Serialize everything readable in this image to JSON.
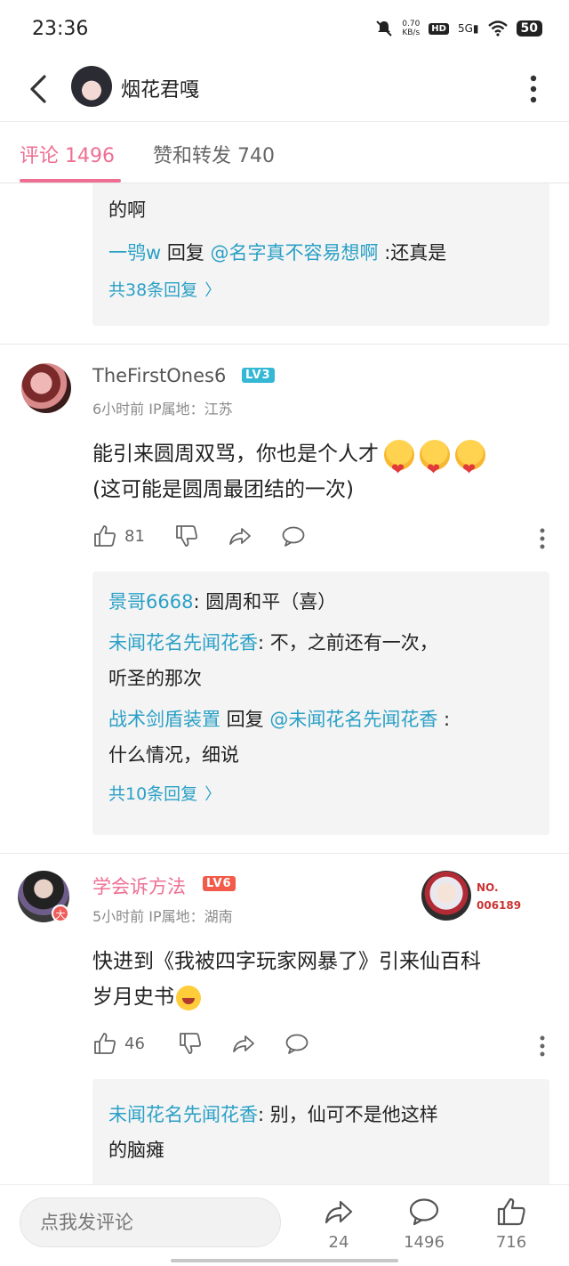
{
  "status_bar": {
    "time": "23:36",
    "net_speed_value": "0.70",
    "net_speed_unit": "KB/s",
    "hd": "HD",
    "signal": "5G",
    "battery": "50"
  },
  "header": {
    "title": "烟花君嘎"
  },
  "tabs": [
    {
      "label": "评论 1496",
      "active": true
    },
    {
      "label": "赞和转发 740",
      "active": false
    }
  ],
  "thread0": {
    "partial_line": "的啊",
    "reply_user": "一鸮w",
    "reply_word": " 回复 ",
    "reply_target": "@名字真不容易想啊",
    "reply_text": " :还真是",
    "more_label": "共38条回复"
  },
  "comments": [
    {
      "username": "TheFirstOnes6",
      "level": "LV3",
      "meta": "6小时前  IP属地：江苏",
      "text_line1": "能引来圆周双骂，你也是个人才",
      "text_line2": "(这可能是圆周最团结的一次)",
      "likes": "81",
      "replies": [
        {
          "user": "景哥6668",
          "text": ": 圆周和平（喜）"
        },
        {
          "user": "未闻花名先闻花香",
          "text": ": 不，之前还有一次，",
          "text2": "听圣的那次"
        },
        {
          "user": "战术剑盾装置",
          "reply_word": " 回复 ",
          "target": "@未闻花名先闻花香",
          "text": " :",
          "text2": "什么情况，细说"
        }
      ],
      "more_label": "共10条回复"
    },
    {
      "username": "学会诉方法",
      "level": "LV6",
      "meta": "5小时前  IP属地：湖南",
      "avatar_badge": "大",
      "nft_label": "NO.",
      "nft_number": "006189",
      "text_line1": "快进到《我被四字玩家网暴了》引来仙百科",
      "text_line2": "岁月史书",
      "likes": "46",
      "replies": [
        {
          "user": "未闻花名先闻花香",
          "text": ": 别，仙可不是他这样",
          "text2": "的脑瘫"
        }
      ]
    }
  ],
  "bottom_bar": {
    "input_placeholder": "点我发评论",
    "share_count": "24",
    "comment_count": "1496",
    "like_count": "716"
  },
  "colors": {
    "accent_pink": "#ef6f93",
    "link_blue": "#2aa0c6",
    "lv3_blue": "#35b7d6",
    "lv6_red": "#f25b4a"
  }
}
